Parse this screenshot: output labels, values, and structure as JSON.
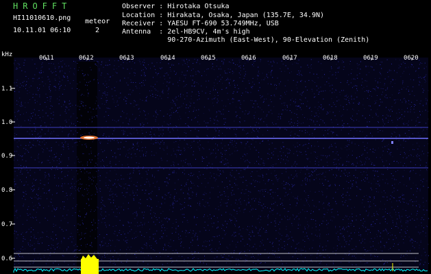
{
  "header": {
    "app_title": "HROFFT",
    "filename": "HI11010610.png",
    "meteor_label": "meteor",
    "meteor_count": "2",
    "timestamp": "10.11.01 06:10",
    "observer_line": "Observer : Hirotaka Otsuka",
    "location_line": "Location : Hirakata, Osaka, Japan (135.7E, 34.9N)",
    "receiver_line": "Receiver : YAESU FT-690 53.749MHz, USB",
    "antenna_line": "Antenna  : 2el-HB9CV, 4m's high",
    "antenna_line2": "           90-270-Azimuth (East-West), 90-Elevation (Zenith)"
  },
  "axis": {
    "unit": "kHz",
    "y_ticks": [
      "1.1",
      "1.0",
      "0.9",
      "0.8",
      "0.7",
      "0.6"
    ],
    "x_ticks": [
      "0611",
      "0612",
      "0613",
      "0614",
      "0615",
      "0616",
      "0617",
      "0618",
      "0619",
      "0620"
    ]
  },
  "colors": {
    "background": "#000000",
    "noise": "#1a1a80",
    "text_accent": "#60e060",
    "signal_yellow": "#ffff00",
    "signal_cyan": "#00ffff",
    "grid": "#ffffff"
  }
}
